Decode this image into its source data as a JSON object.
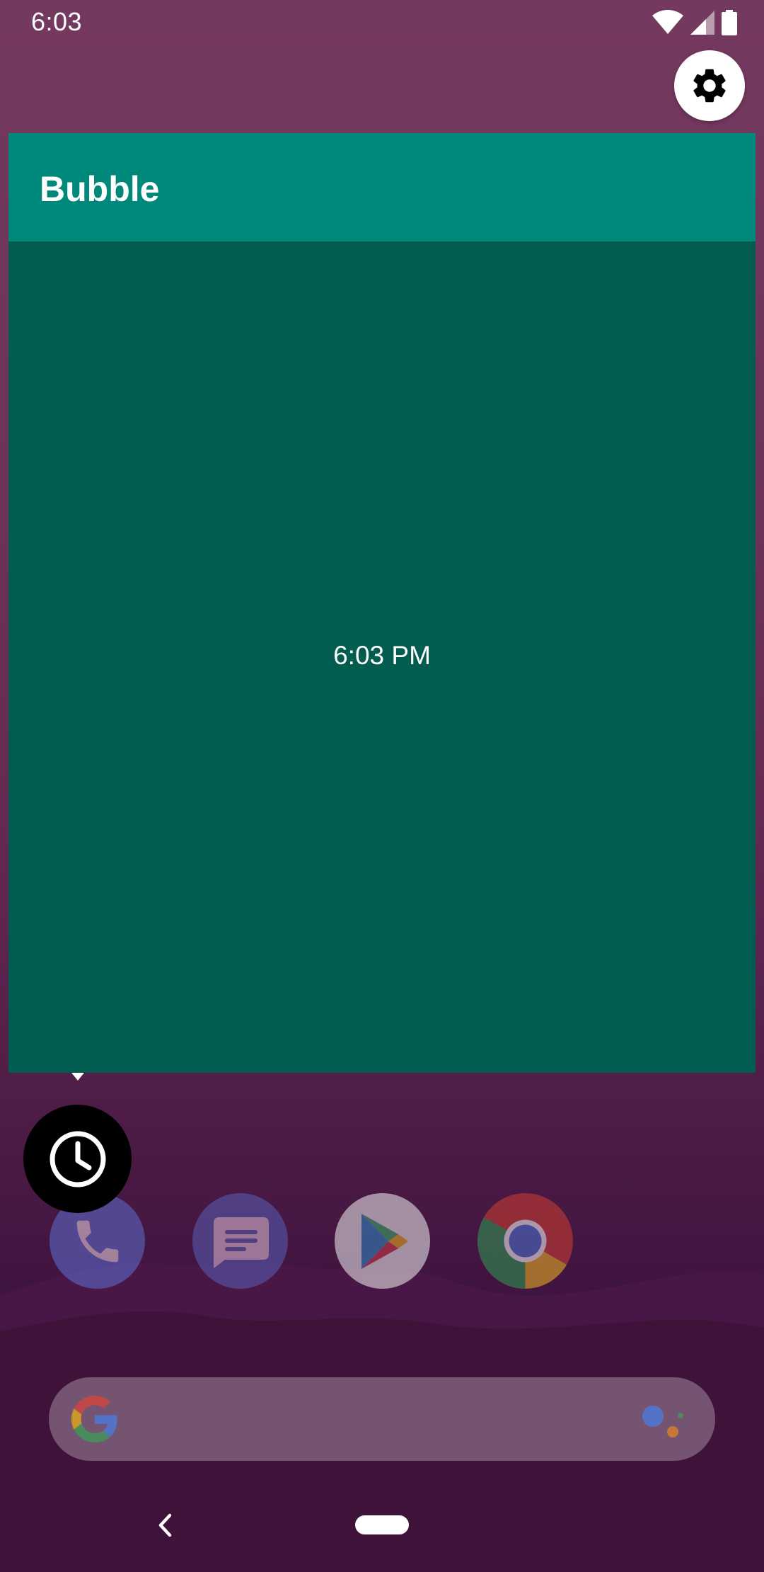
{
  "status_bar": {
    "time": "6:03",
    "icons": [
      "wifi-icon",
      "cell-signal-icon",
      "battery-icon"
    ]
  },
  "settings": {
    "icon": "gear-icon"
  },
  "bubble": {
    "title": "Bubble",
    "clock_text": "6:03 PM",
    "appbar_color": "#00887a",
    "body_color": "#025c50",
    "floating_icon": "clock-icon"
  },
  "dock": {
    "apps": [
      "phone-icon",
      "messages-icon",
      "play-store-icon",
      "chrome-icon"
    ]
  },
  "search": {
    "left_icon": "google-g-icon",
    "right_icon": "assistant-icon"
  },
  "nav_bar": {
    "buttons": [
      "back-icon",
      "home-pill"
    ]
  }
}
